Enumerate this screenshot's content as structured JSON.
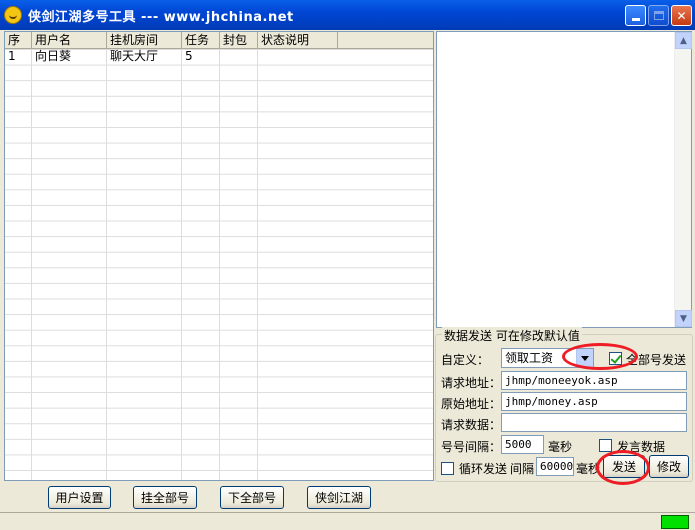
{
  "window": {
    "title": "侠剑江湖多号工具 --- www.jhchina.net"
  },
  "table": {
    "columns": [
      "序",
      "用户名",
      "挂机房间",
      "任务",
      "封包",
      "状态说明"
    ],
    "rows": [
      [
        "1",
        "向日葵",
        "聊天大厅",
        "5",
        "",
        ""
      ]
    ]
  },
  "group": {
    "label": "数据发送 可在修改默认值"
  },
  "form": {
    "custom_label": "自定义：",
    "custom_value": "领取工资",
    "all_send_label": "全部号发送",
    "all_send_checked": true,
    "request_url_label": "请求地址：",
    "request_url_value": "jhmp/moneeyok.asp",
    "origin_url_label": "原始地址：",
    "origin_url_value": "jhmp/money.asp",
    "request_data_label": "请求数据：",
    "request_data_value": "",
    "interval_label": "号号间隔：",
    "interval_value": "5000",
    "interval_unit": "毫秒",
    "speech_data_label": "发言数据",
    "speech_data_checked": false,
    "loop_send_label": "循环发送",
    "loop_send_checked": false,
    "loop_interval_label": "间隔",
    "loop_interval_value": "60000",
    "loop_interval_unit": "毫秒",
    "send_button": "发送",
    "modify_button": "修改"
  },
  "buttons": {
    "user_settings": "用户设置",
    "hang_all": "挂全部号",
    "unhang_all": "下全部号",
    "xiajian": "侠剑江湖"
  },
  "colors": {
    "title_bar": "#0046d5",
    "annotation": "#ee1c24",
    "status_indicator": "#00e000"
  }
}
